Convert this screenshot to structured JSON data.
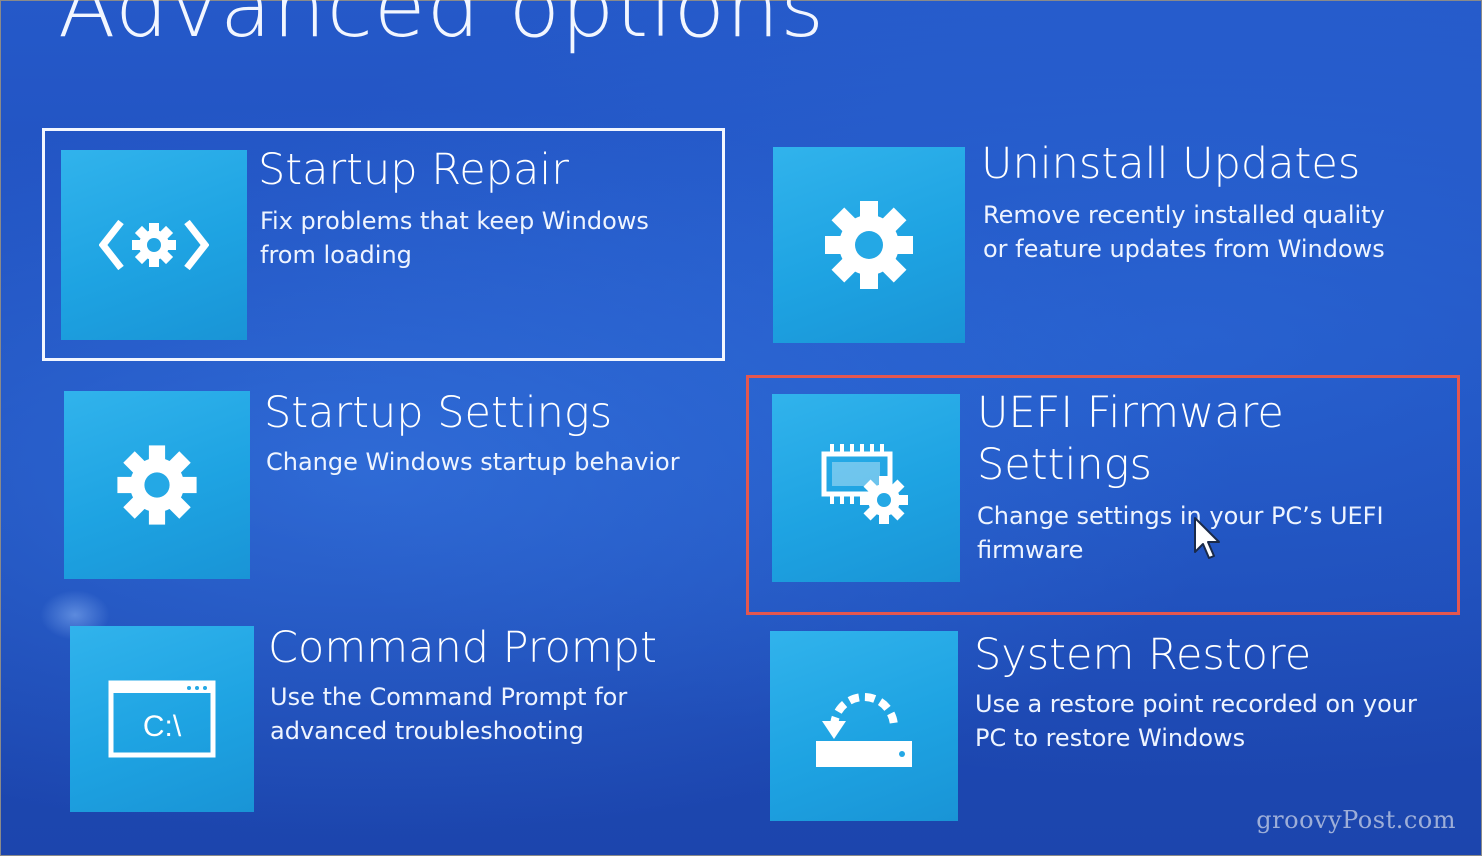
{
  "page": {
    "title": "Advanced options"
  },
  "options": [
    {
      "id": "startup-repair",
      "title": "Startup Repair",
      "description": "Fix problems that keep Windows from loading",
      "icon": "startup-repair-icon",
      "selected": true
    },
    {
      "id": "uninstall-updates",
      "title": "Uninstall Updates",
      "description": "Remove recently installed quality or feature updates from Windows",
      "icon": "gear-icon"
    },
    {
      "id": "startup-settings",
      "title": "Startup Settings",
      "description": "Change Windows startup behavior",
      "icon": "gear-icon"
    },
    {
      "id": "uefi-firmware-settings",
      "title": "UEFI Firmware Settings",
      "description": "Change settings in your PC’s UEFI firmware",
      "icon": "firmware-chip-gear-icon",
      "highlighted": true
    },
    {
      "id": "command-prompt",
      "title": "Command Prompt",
      "description": "Use the Command Prompt for advanced troubleshooting",
      "icon": "command-prompt-icon",
      "icon_text": "C:\\"
    },
    {
      "id": "system-restore",
      "title": "System Restore",
      "description": "Use a restore point recorded on your PC to restore Windows",
      "icon": "system-restore-icon"
    }
  ],
  "watermark": {
    "text": "groovyPost.com"
  },
  "colors": {
    "background": "#1e4cba",
    "tile": "#1ea3e2",
    "highlight": "#e4574f",
    "selection_border": "#f2f6ff"
  }
}
